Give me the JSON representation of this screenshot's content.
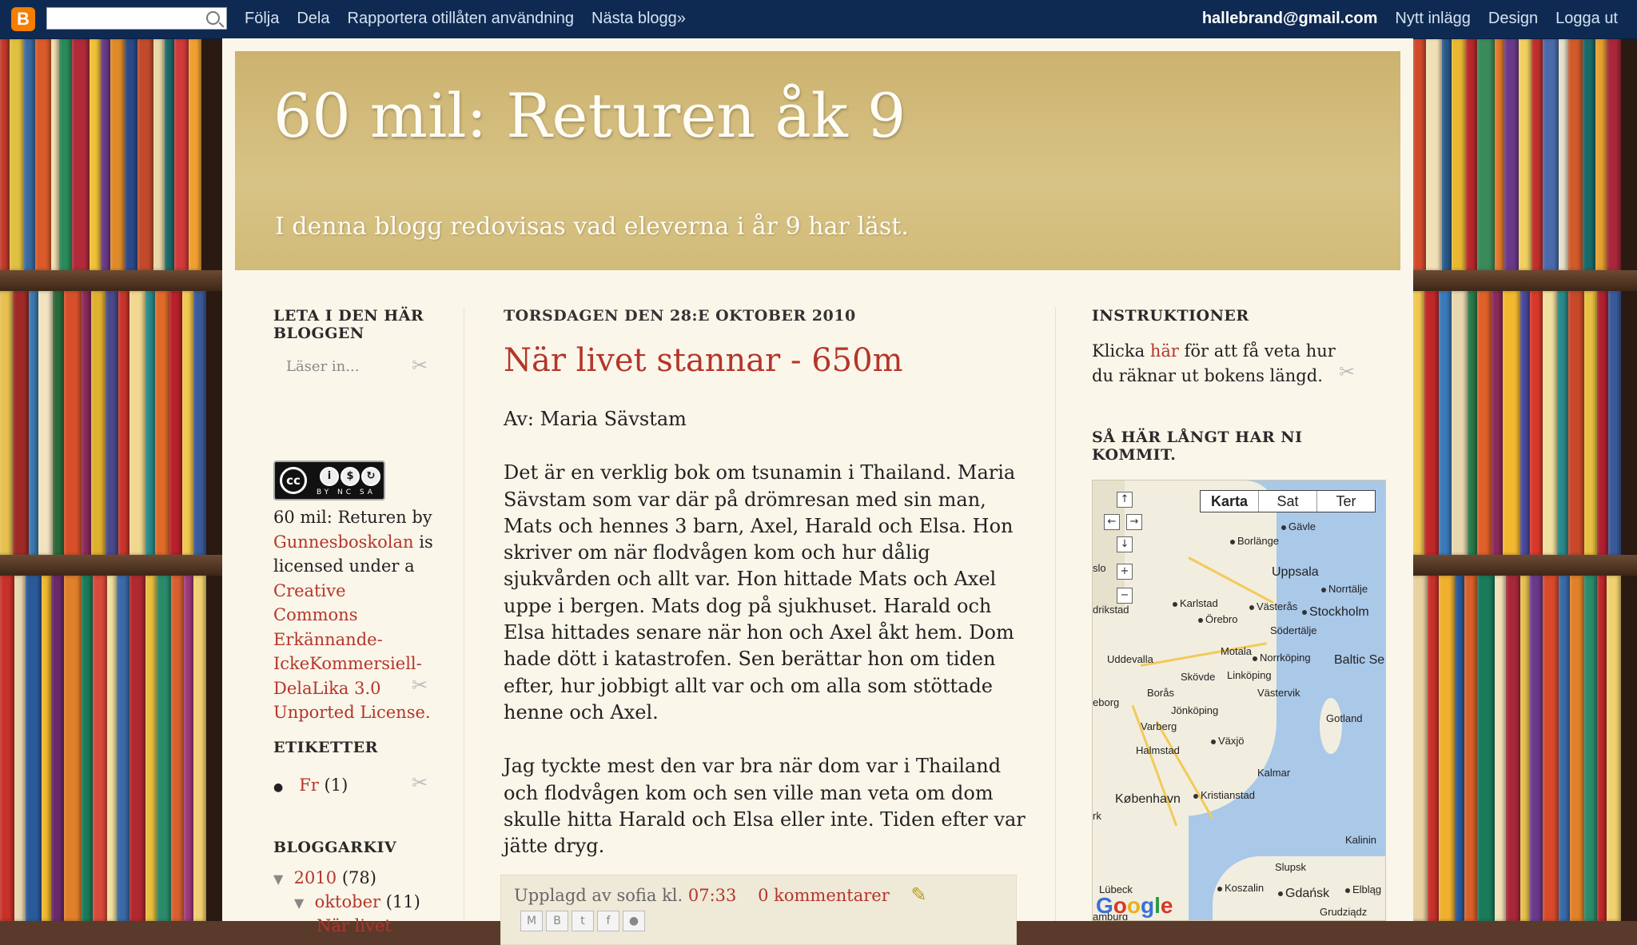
{
  "navbar": {
    "logo": "B",
    "links": [
      "Följa",
      "Dela",
      "Rapportera otillåten användning",
      "Nästa blogg»"
    ],
    "email": "hallebrand@gmail.com",
    "right_links": [
      "Nytt inlägg",
      "Design",
      "Logga ut"
    ]
  },
  "header": {
    "title": "60 mil: Returen åk 9",
    "description": "I denna blogg redovisas vad eleverna i år 9 har läst."
  },
  "left": {
    "search_title": "LETA I DEN HÄR BLOGGEN",
    "search_placeholder": "Läser in...",
    "license": {
      "badge_cc": "cc",
      "badge_text": "BY NC SA",
      "prefix": "60 mil: Returen by",
      "author_link": "Gunnesboskolan",
      "middle": "is licensed under a",
      "license_link": "Creative Commons Erkännande-IckeKommersiell-DelaLika 3.0 Unported License."
    },
    "labels_title": "ETIKETTER",
    "labels": [
      {
        "name": "Fr",
        "count": "(1)"
      }
    ],
    "archive_title": "BLOGGARKIV",
    "archive": {
      "year": "2010",
      "year_count": "(78)",
      "month": "oktober",
      "month_count": "(11)",
      "post": "När livet"
    }
  },
  "post": {
    "date": "TORSDAGEN DEN 28:E OKTOBER 2010",
    "title": "När livet stannar - 650m",
    "paragraphs": [
      "Av: Maria Sävstam",
      "Det är en verklig bok om tsunamin i Thailand. Maria Sävstam som var där på drömresan med sin man, Mats och hennes 3 barn, Axel, Harald och Elsa. Hon skriver om när flodvågen kom och hur dålig sjukvården och allt var. Hon hittade Mats och Axel uppe i bergen. Mats dog på sjukhuset. Harald och Elsa hittades senare när hon och Axel åkt hem. Dom hade dött i katastrofen. Sen berättar hon om tiden efter, hur jobbigt allt var och om alla som stöttade henne och Axel.",
      "Jag tyckte mest den var bra när dom var i Thailand och flodvågen kom och sen ville man veta om dom skulle hitta Harald och Elsa eller inte. Tiden efter var jätte dryg."
    ],
    "footer": {
      "posted_by": "Upplagd av sofia kl.",
      "time": "07:33",
      "comments": "0 kommentarer"
    }
  },
  "right": {
    "instr_title": "INSTRUKTIONER",
    "instr_text_before": "Klicka",
    "instr_link": "här",
    "instr_text_after": "för att få veta hur du räknar ut bokens längd.",
    "map_title": "SÅ HÄR LÅNGT HAR NI KOMMIT.",
    "map_tabs": [
      "Karta",
      "Sat",
      "Ter"
    ],
    "cities": [
      "Gävle",
      "Borlänge",
      "Uppsala",
      "Norrtälje",
      "Karlstad",
      "Västerås",
      "Stockholm",
      "Örebro",
      "Södertälje",
      "Uddevalla",
      "Motala",
      "Norrköping",
      "Baltic Se",
      "Skövde",
      "Linköping",
      "Borås",
      "Västervik",
      "Jönköping",
      "Gotland",
      "Varberg",
      "Växjö",
      "Halmstad",
      "Kalmar",
      "København",
      "Kristianstad",
      "Kalinin",
      "Slupsk",
      "Lübeck",
      "Koszalin",
      "Gdańsk",
      "Elbląg",
      "Grudziądz",
      "eborg",
      "slo",
      "drikstad",
      "rk",
      "amburg"
    ],
    "map_logo": "Google"
  },
  "colors": {
    "navbar_bg": "#0f2a52",
    "link": "#b5352a",
    "header_bg": "#d8c386",
    "page_bg": "#fbf6ea"
  }
}
